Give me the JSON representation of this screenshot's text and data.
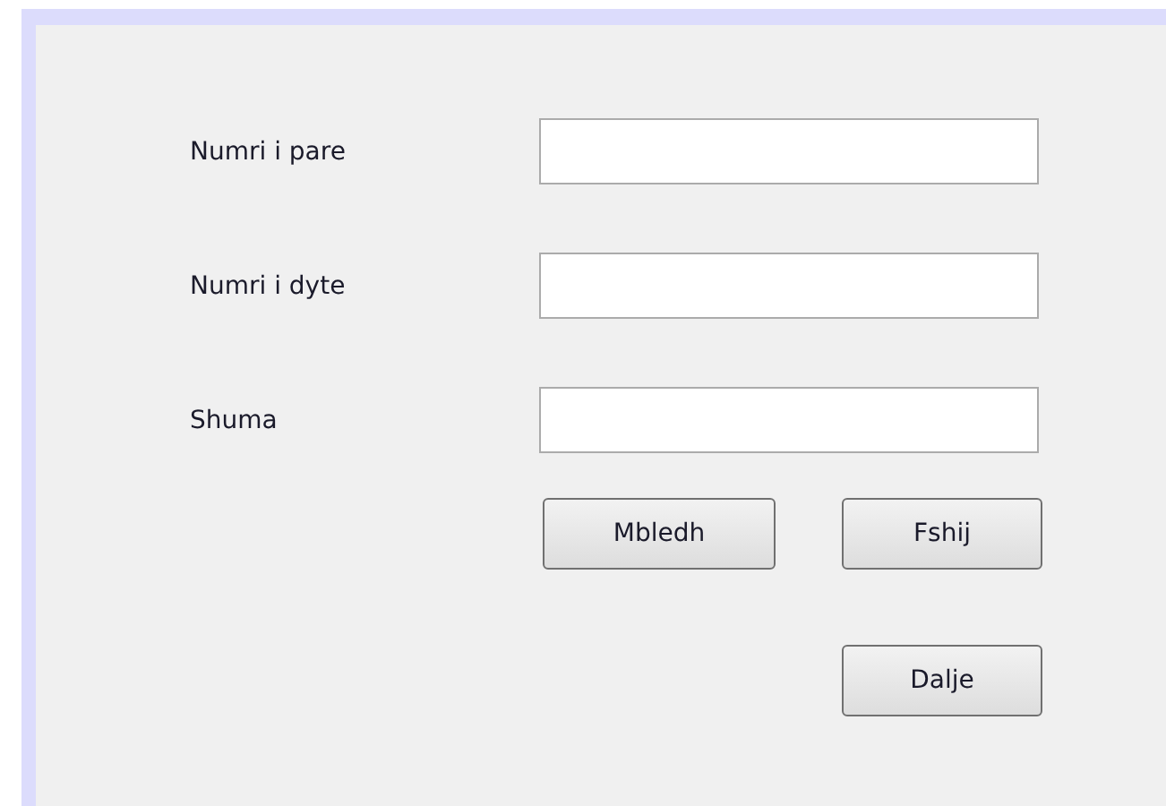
{
  "fields": [
    {
      "label": "Numri i pare"
    },
    {
      "label": "Numri i dyte"
    },
    {
      "label": "Shuma"
    }
  ],
  "button_rows": [
    [
      "Mbledh",
      "Fshij"
    ],
    [
      "Dalje"
    ]
  ]
}
